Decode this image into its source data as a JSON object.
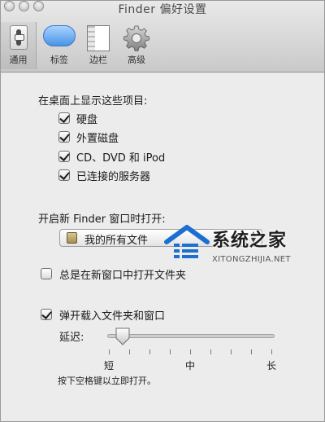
{
  "window": {
    "title": "Finder 偏好设置"
  },
  "toolbar": {
    "items": [
      {
        "label": "通用",
        "icon": "switch-icon",
        "selected": true
      },
      {
        "label": "标签",
        "icon": "tag-icon",
        "selected": false
      },
      {
        "label": "边栏",
        "icon": "sidebar-icon",
        "selected": false
      },
      {
        "label": "高级",
        "icon": "gear-icon",
        "selected": false
      }
    ]
  },
  "desktop_section": {
    "heading": "在桌面上显示这些项目:",
    "items": [
      {
        "label": "硬盘",
        "checked": true
      },
      {
        "label": "外置磁盘",
        "checked": true
      },
      {
        "label": "CD、DVD 和 iPod",
        "checked": true
      },
      {
        "label": "已连接的服务器",
        "checked": true
      }
    ]
  },
  "new_window": {
    "heading": "开启新 Finder 窗口时打开:",
    "selected": "我的所有文件",
    "icon": "documents-icon"
  },
  "folders_in_new_window": {
    "label": "总是在新窗口中打开文件夹",
    "checked": false
  },
  "spring_loaded": {
    "label": "弹开载入文件夹和窗口",
    "checked": true,
    "delay_label": "延迟:",
    "delay_value": 0.05,
    "ticks": [
      "短",
      "中",
      "长"
    ],
    "hint": "按下空格键以立即打开。"
  },
  "watermark": {
    "title": "系统之家",
    "url": "XITONGZHIJIA.NET"
  },
  "colors": {
    "window_bg": "#ececec",
    "tag_blue": "#4a93e6"
  }
}
